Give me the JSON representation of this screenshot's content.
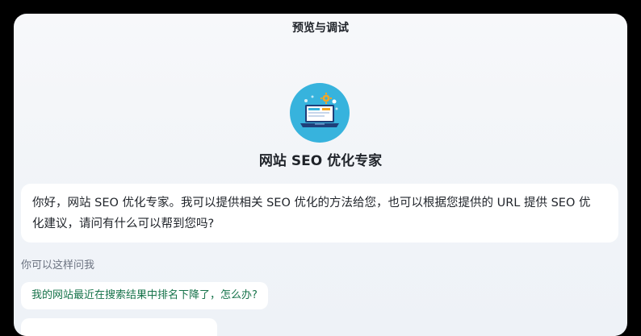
{
  "panel": {
    "title": "预览与调试"
  },
  "agent": {
    "name": "网站 SEO 优化专家",
    "avatar_icon": "laptop-seo-icon",
    "avatar_color": "#37b3dd"
  },
  "welcome": {
    "line1": "你好，网站 SEO 优化专家。我可以提供相关 SEO 优化的方法给您，也可以根据您提供的 URL 提供 SEO 优",
    "line2": "化建议，请问有什么可以帮到您吗?"
  },
  "suggestions": {
    "label": "你可以这样问我",
    "items": [
      "我的网站最近在搜索结果中排名下降了，怎么办?"
    ],
    "text_color": "#16734a"
  }
}
